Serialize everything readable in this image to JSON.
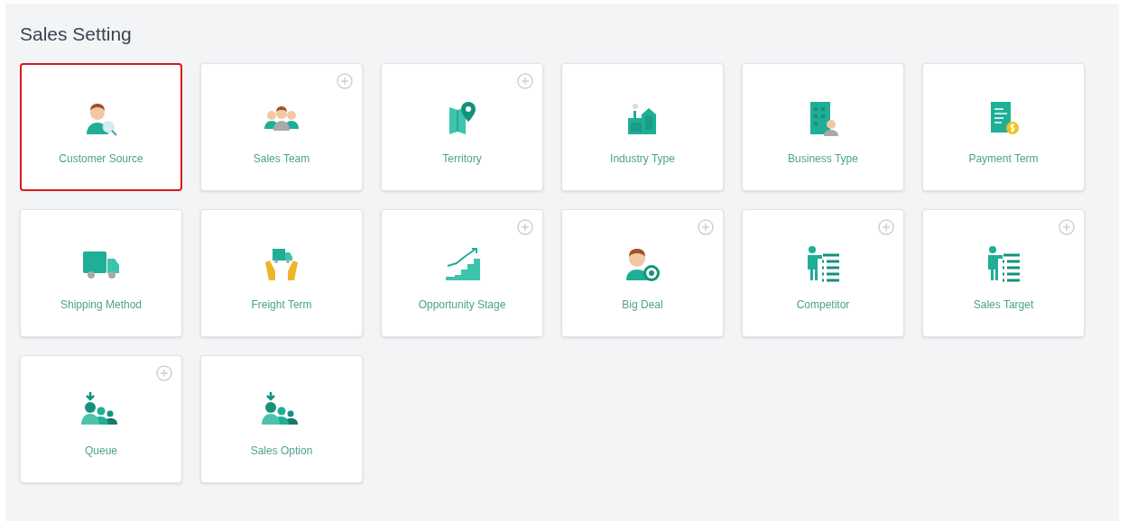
{
  "title": "Sales Setting",
  "cards": [
    {
      "label": "Customer Source",
      "kind": "customer",
      "selected": true,
      "add": false
    },
    {
      "label": "Sales Team",
      "kind": "team",
      "selected": false,
      "add": true
    },
    {
      "label": "Territory",
      "kind": "territory",
      "selected": false,
      "add": true
    },
    {
      "label": "Industry Type",
      "kind": "industry",
      "selected": false,
      "add": false
    },
    {
      "label": "Business Type",
      "kind": "business",
      "selected": false,
      "add": false
    },
    {
      "label": "Payment Term",
      "kind": "payment",
      "selected": false,
      "add": false
    },
    {
      "label": "Shipping Method",
      "kind": "truck",
      "selected": false,
      "add": false
    },
    {
      "label": "Freight Term",
      "kind": "freight",
      "selected": false,
      "add": false
    },
    {
      "label": "Opportunity Stage",
      "kind": "growth",
      "selected": false,
      "add": true
    },
    {
      "label": "Big Deal",
      "kind": "bigdeal",
      "selected": false,
      "add": true
    },
    {
      "label": "Competitor",
      "kind": "presenter",
      "selected": false,
      "add": true
    },
    {
      "label": "Sales Target",
      "kind": "presenter",
      "selected": false,
      "add": true
    },
    {
      "label": "Queue",
      "kind": "queue",
      "selected": false,
      "add": true
    },
    {
      "label": "Sales Option",
      "kind": "queue",
      "selected": false,
      "add": false
    }
  ]
}
